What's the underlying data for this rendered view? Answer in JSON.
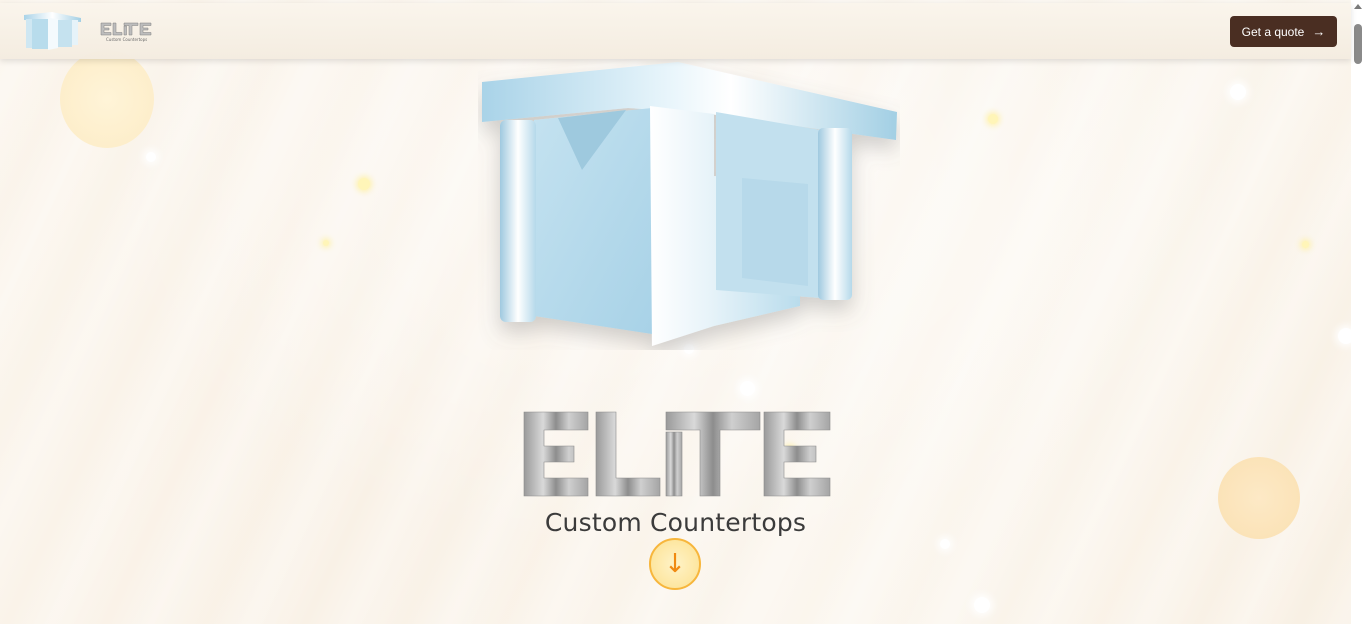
{
  "header": {
    "brand_name": "ELITE",
    "brand_sub": "Custom Countertops",
    "quote_button": "Get a quote",
    "quote_icon": "arrow-right-icon"
  },
  "hero": {
    "brand_name": "ELITE",
    "tagline": "Custom Countertops",
    "scroll_icon": "arrow-down-icon",
    "scroll_glyph": "↓"
  },
  "colors": {
    "button_bg": "#4a2e22",
    "accent": "#f7b63c",
    "background": "#fbf5ec",
    "logo_blue": "#b8dcec"
  }
}
